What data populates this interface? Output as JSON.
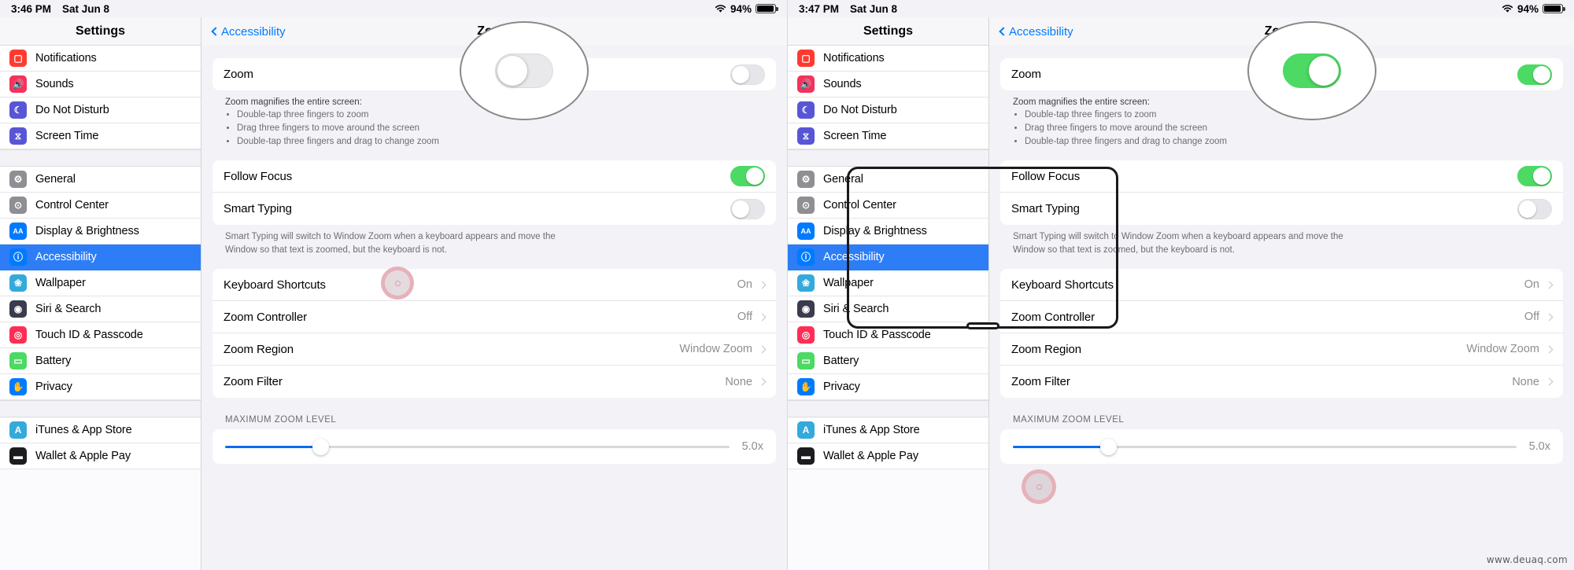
{
  "watermark": "www.deuaq.com",
  "screens": [
    {
      "status": {
        "time": "3:46 PM",
        "date": "Sat Jun 8",
        "battery_percent": "94%",
        "wifi_icon": "wifi-icon",
        "battery_icon": "battery-icon",
        "battery_level": 94
      },
      "sidebar": {
        "title": "Settings",
        "groups": [
          {
            "items": [
              {
                "label": "Notifications",
                "icon": "notifications-icon",
                "color": "#ff3b30",
                "glyph": "▢",
                "selected": false
              },
              {
                "label": "Sounds",
                "icon": "sounds-icon",
                "color": "#f5325b",
                "glyph": "🔊",
                "selected": false
              },
              {
                "label": "Do Not Disturb",
                "icon": "do-not-disturb-icon",
                "color": "#5856d6",
                "glyph": "☾",
                "selected": false
              },
              {
                "label": "Screen Time",
                "icon": "screen-time-icon",
                "color": "#5856d6",
                "glyph": "⧖",
                "selected": false
              }
            ]
          },
          {
            "items": [
              {
                "label": "General",
                "icon": "general-icon",
                "color": "#8e8e93",
                "glyph": "⚙",
                "selected": false
              },
              {
                "label": "Control Center",
                "icon": "control-center-icon",
                "color": "#8e8e93",
                "glyph": "⊙",
                "selected": false
              },
              {
                "label": "Display & Brightness",
                "icon": "display-brightness-icon",
                "color": "#007aff",
                "glyph": "AA",
                "selected": false
              },
              {
                "label": "Accessibility",
                "icon": "accessibility-icon",
                "color": "#007aff",
                "glyph": "ⓘ",
                "selected": true
              },
              {
                "label": "Wallpaper",
                "icon": "wallpaper-icon",
                "color": "#34aadc",
                "glyph": "❀",
                "selected": false
              },
              {
                "label": "Siri & Search",
                "icon": "siri-search-icon",
                "color": "#3b3b4e",
                "glyph": "◉",
                "selected": false
              },
              {
                "label": "Touch ID & Passcode",
                "icon": "touch-id-passcode-icon",
                "color": "#ff2d55",
                "glyph": "◎",
                "selected": false
              },
              {
                "label": "Battery",
                "icon": "battery-settings-icon",
                "color": "#4cd964",
                "glyph": "▭",
                "selected": false
              },
              {
                "label": "Privacy",
                "icon": "privacy-icon",
                "color": "#007aff",
                "glyph": "✋",
                "selected": false
              }
            ]
          },
          {
            "items": [
              {
                "label": "iTunes & App Store",
                "icon": "itunes-app-store-icon",
                "color": "#34aadc",
                "glyph": "A",
                "selected": false
              },
              {
                "label": "Wallet & Apple Pay",
                "icon": "wallet-apple-pay-icon",
                "color": "#1c1c1e",
                "glyph": "▬",
                "selected": false
              }
            ]
          }
        ]
      },
      "detail": {
        "back_label": "Accessibility",
        "title": "Zoom",
        "zoom_row": {
          "label": "Zoom",
          "enabled": false
        },
        "zoom_footnote_head": "Zoom magnifies the entire screen:",
        "zoom_footnote_items": [
          "Double-tap three fingers to zoom",
          "Drag three fingers to move around the screen",
          "Double-tap three fingers and drag to change zoom"
        ],
        "follow_focus": {
          "label": "Follow Focus",
          "enabled": true
        },
        "smart_typing": {
          "label": "Smart Typing",
          "enabled": false
        },
        "smart_typing_footnote": "Smart Typing will switch to Window Zoom when a keyboard appears and move the Window so that text is zoomed, but the keyboard is not.",
        "options": [
          {
            "label": "Keyboard Shortcuts",
            "value": "On"
          },
          {
            "label": "Zoom Controller",
            "value": "Off"
          },
          {
            "label": "Zoom Region",
            "value": "Window Zoom"
          },
          {
            "label": "Zoom Filter",
            "value": "None"
          }
        ],
        "slider_section_label": "MAXIMUM ZOOM LEVEL",
        "slider_value": "5.0x",
        "slider_fill_percent": 19
      },
      "callout": {
        "toggle_on": false
      },
      "touch_indicator": {
        "visible": true
      },
      "zoom_window": {
        "visible": false
      }
    },
    {
      "status": {
        "time": "3:47 PM",
        "date": "Sat Jun 8",
        "battery_percent": "94%",
        "wifi_icon": "wifi-icon",
        "battery_icon": "battery-icon",
        "battery_level": 94
      },
      "sidebar": {
        "title": "Settings",
        "groups": [
          {
            "items": [
              {
                "label": "Notifications",
                "icon": "notifications-icon",
                "color": "#ff3b30",
                "glyph": "▢",
                "selected": false
              },
              {
                "label": "Sounds",
                "icon": "sounds-icon",
                "color": "#f5325b",
                "glyph": "🔊",
                "selected": false
              },
              {
                "label": "Do Not Disturb",
                "icon": "do-not-disturb-icon",
                "color": "#5856d6",
                "glyph": "☾",
                "selected": false
              },
              {
                "label": "Screen Time",
                "icon": "screen-time-icon",
                "color": "#5856d6",
                "glyph": "⧖",
                "selected": false
              }
            ]
          },
          {
            "items": [
              {
                "label": "General",
                "icon": "general-icon",
                "color": "#8e8e93",
                "glyph": "⚙",
                "selected": false
              },
              {
                "label": "Control Center",
                "icon": "control-center-icon",
                "color": "#8e8e93",
                "glyph": "⊙",
                "selected": false
              },
              {
                "label": "Display & Brightness",
                "icon": "display-brightness-icon",
                "color": "#007aff",
                "glyph": "AA",
                "selected": false
              },
              {
                "label": "Accessibility",
                "icon": "accessibility-icon",
                "color": "#007aff",
                "glyph": "ⓘ",
                "selected": true
              },
              {
                "label": "Wallpaper",
                "icon": "wallpaper-icon",
                "color": "#34aadc",
                "glyph": "❀",
                "selected": false
              },
              {
                "label": "Siri & Search",
                "icon": "siri-search-icon",
                "color": "#3b3b4e",
                "glyph": "◉",
                "selected": false
              },
              {
                "label": "Touch ID & Passcode",
                "icon": "touch-id-passcode-icon",
                "color": "#ff2d55",
                "glyph": "◎",
                "selected": false
              },
              {
                "label": "Battery",
                "icon": "battery-settings-icon",
                "color": "#4cd964",
                "glyph": "▭",
                "selected": false
              },
              {
                "label": "Privacy",
                "icon": "privacy-icon",
                "color": "#007aff",
                "glyph": "✋",
                "selected": false
              }
            ]
          },
          {
            "items": [
              {
                "label": "iTunes & App Store",
                "icon": "itunes-app-store-icon",
                "color": "#34aadc",
                "glyph": "A",
                "selected": false
              },
              {
                "label": "Wallet & Apple Pay",
                "icon": "wallet-apple-pay-icon",
                "color": "#1c1c1e",
                "glyph": "▬",
                "selected": false
              }
            ]
          }
        ]
      },
      "detail": {
        "back_label": "Accessibility",
        "title": "Zoom",
        "zoom_row": {
          "label": "Zoom",
          "enabled": true
        },
        "zoom_footnote_head": "Zoom magnifies the entire screen:",
        "zoom_footnote_items": [
          "Double-tap three fingers to zoom",
          "Drag three fingers to move around the screen",
          "Double-tap three fingers and drag to change zoom"
        ],
        "follow_focus": {
          "label": "Follow Focus",
          "enabled": true
        },
        "smart_typing": {
          "label": "Smart Typing",
          "enabled": false
        },
        "smart_typing_footnote": "Smart Typing will switch to Window Zoom when a keyboard appears and move the Window so that text is zoomed, but the keyboard is not.",
        "options": [
          {
            "label": "Keyboard Shortcuts",
            "value": "On"
          },
          {
            "label": "Zoom Controller",
            "value": "Off"
          },
          {
            "label": "Zoom Region",
            "value": "Window Zoom"
          },
          {
            "label": "Zoom Filter",
            "value": "None"
          }
        ],
        "slider_section_label": "MAXIMUM ZOOM LEVEL",
        "slider_value": "5.0x",
        "slider_fill_percent": 19
      },
      "callout": {
        "toggle_on": true
      },
      "touch_indicator": {
        "visible": true
      },
      "zoom_window": {
        "visible": true
      }
    }
  ]
}
